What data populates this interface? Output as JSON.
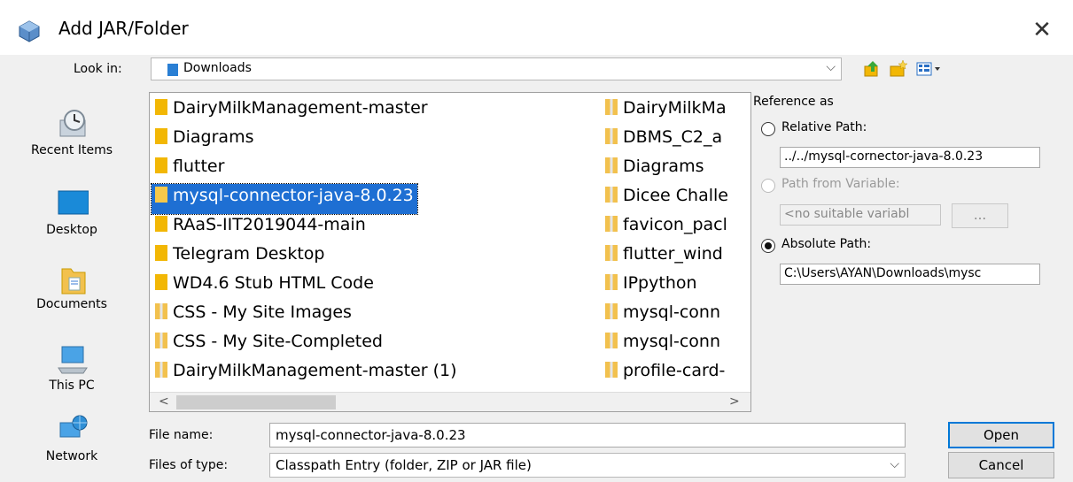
{
  "window": {
    "title": "Add JAR/Folder",
    "close_glyph": "✕"
  },
  "look_in": {
    "label": "Look in:",
    "value": "Downloads",
    "arrow": "⌵"
  },
  "places": [
    {
      "label": "Recent Items",
      "icon": "clock-icon"
    },
    {
      "label": "Desktop",
      "icon": "desktop-icon"
    },
    {
      "label": "Documents",
      "icon": "documents-icon"
    },
    {
      "label": "This PC",
      "icon": "computer-icon"
    },
    {
      "label": "Network",
      "icon": "network-icon"
    }
  ],
  "files": {
    "column1": [
      {
        "name": "DairyMilkManagement-master",
        "type": "folder"
      },
      {
        "name": "Diagrams",
        "type": "folder"
      },
      {
        "name": "flutter",
        "type": "folder"
      },
      {
        "name": "mysql-connector-java-8.0.23",
        "type": "folder",
        "selected": true
      },
      {
        "name": "RAaS-IIT2019044-main",
        "type": "folder"
      },
      {
        "name": "Telegram Desktop",
        "type": "folder"
      },
      {
        "name": "WD4.6 Stub HTML Code",
        "type": "folder"
      },
      {
        "name": "CSS - My Site Images",
        "type": "zip"
      },
      {
        "name": "CSS - My Site-Completed",
        "type": "zip"
      },
      {
        "name": "DairyMilkManagement-master (1)",
        "type": "zip"
      }
    ],
    "column2": [
      {
        "name": "DairyMilkMa",
        "type": "zip"
      },
      {
        "name": "DBMS_C2_a",
        "type": "zip"
      },
      {
        "name": "Diagrams",
        "type": "zip"
      },
      {
        "name": "Dicee Challe",
        "type": "zip"
      },
      {
        "name": "favicon_pacl",
        "type": "zip"
      },
      {
        "name": "flutter_wind",
        "type": "zip"
      },
      {
        "name": "IPpython",
        "type": "zip"
      },
      {
        "name": "mysql-conn",
        "type": "zip"
      },
      {
        "name": "mysql-conn",
        "type": "zip"
      },
      {
        "name": "profile-card-",
        "type": "zip"
      }
    ],
    "scroll_left": "<",
    "scroll_right": ">"
  },
  "reference": {
    "heading": "Reference as",
    "relative_label": "Relative Path:",
    "relative_value": "../../mysql-cornector-java-8.0.23",
    "variable_label": "Path from Variable:",
    "variable_value": "<no suitable variabl",
    "browse_label": "...",
    "absolute_label": "Absolute Path:",
    "absolute_value": "C:\\Users\\AYAN\\Downloads\\mysc"
  },
  "file_name": {
    "label": "File name:",
    "value": "mysql-connector-java-8.0.23"
  },
  "file_type": {
    "label": "Files of type:",
    "value": "Classpath Entry (folder, ZIP or JAR file)",
    "arrow": "⌵"
  },
  "buttons": {
    "open": "Open",
    "cancel": "Cancel"
  },
  "colors": {
    "selection": "#1e6fd3",
    "folder": "#f2b705",
    "default_button_border": "#0078d7"
  }
}
